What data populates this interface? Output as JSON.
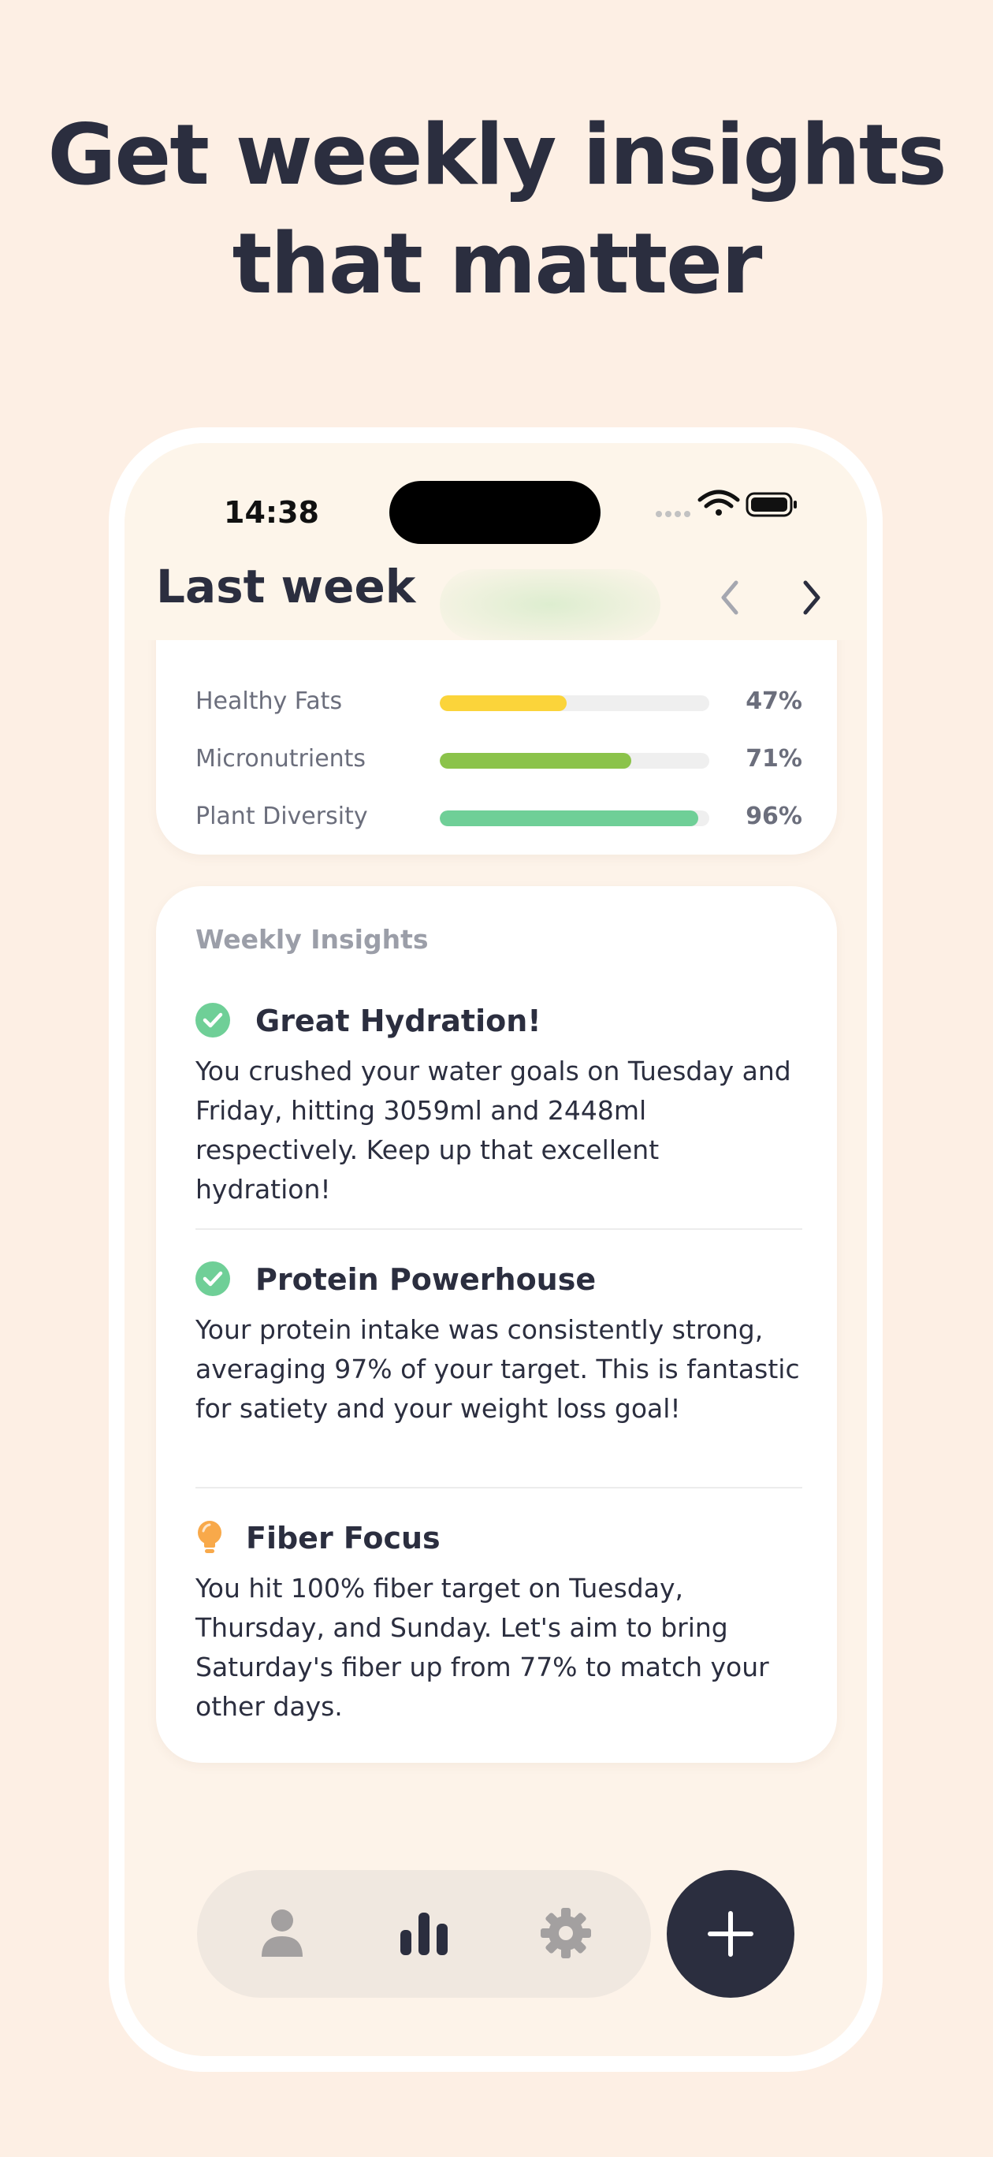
{
  "headline": {
    "line1": "Get weekly insights",
    "line2": "that matter"
  },
  "status_bar": {
    "time": "14:38",
    "icons": [
      "signal-dots-icon",
      "wifi-icon",
      "battery-icon"
    ]
  },
  "header": {
    "title": "Last week",
    "prev_icon": "chevron-left-icon",
    "next_icon": "chevron-right-icon"
  },
  "scores": [
    {
      "label": "Healthy Fats",
      "value_text": "47%",
      "value": 0.47,
      "color": "#fbd43a"
    },
    {
      "label": "Micronutrients",
      "value_text": "71%",
      "value": 0.71,
      "color": "#8bc34a"
    },
    {
      "label": "Plant Diversity",
      "value_text": "96%",
      "value": 0.96,
      "color": "#6fcf97"
    }
  ],
  "insights": {
    "heading": "Weekly Insights",
    "items": [
      {
        "icon": "check-circle-icon",
        "title": "Great Hydration!",
        "body": "You crushed your water goals on Tuesday and Friday, hitting 3059ml and 2448ml respectively. Keep up that excellent hydration!"
      },
      {
        "icon": "check-circle-icon",
        "title": "Protein Powerhouse",
        "body": "Your protein intake was consistently strong, averaging 97% of your target. This is fantastic for satiety and your weight loss goal!"
      },
      {
        "icon": "lightbulb-icon",
        "title": "Fiber Focus",
        "body": "You hit 100% fiber target on Tuesday, Thursday, and Sunday. Let's aim to bring Saturday's fiber up from 77% to match your other days."
      }
    ]
  },
  "tabbar": {
    "tabs": [
      {
        "icon": "person-icon",
        "active": false
      },
      {
        "icon": "bar-chart-icon",
        "active": true
      },
      {
        "icon": "gear-icon",
        "active": false
      }
    ],
    "fab_icon": "plus-icon"
  },
  "colors": {
    "background": "#fdefe4",
    "text_dark": "#2b2e3f",
    "success": "#6fcf97",
    "tip": "#f8a94a"
  }
}
